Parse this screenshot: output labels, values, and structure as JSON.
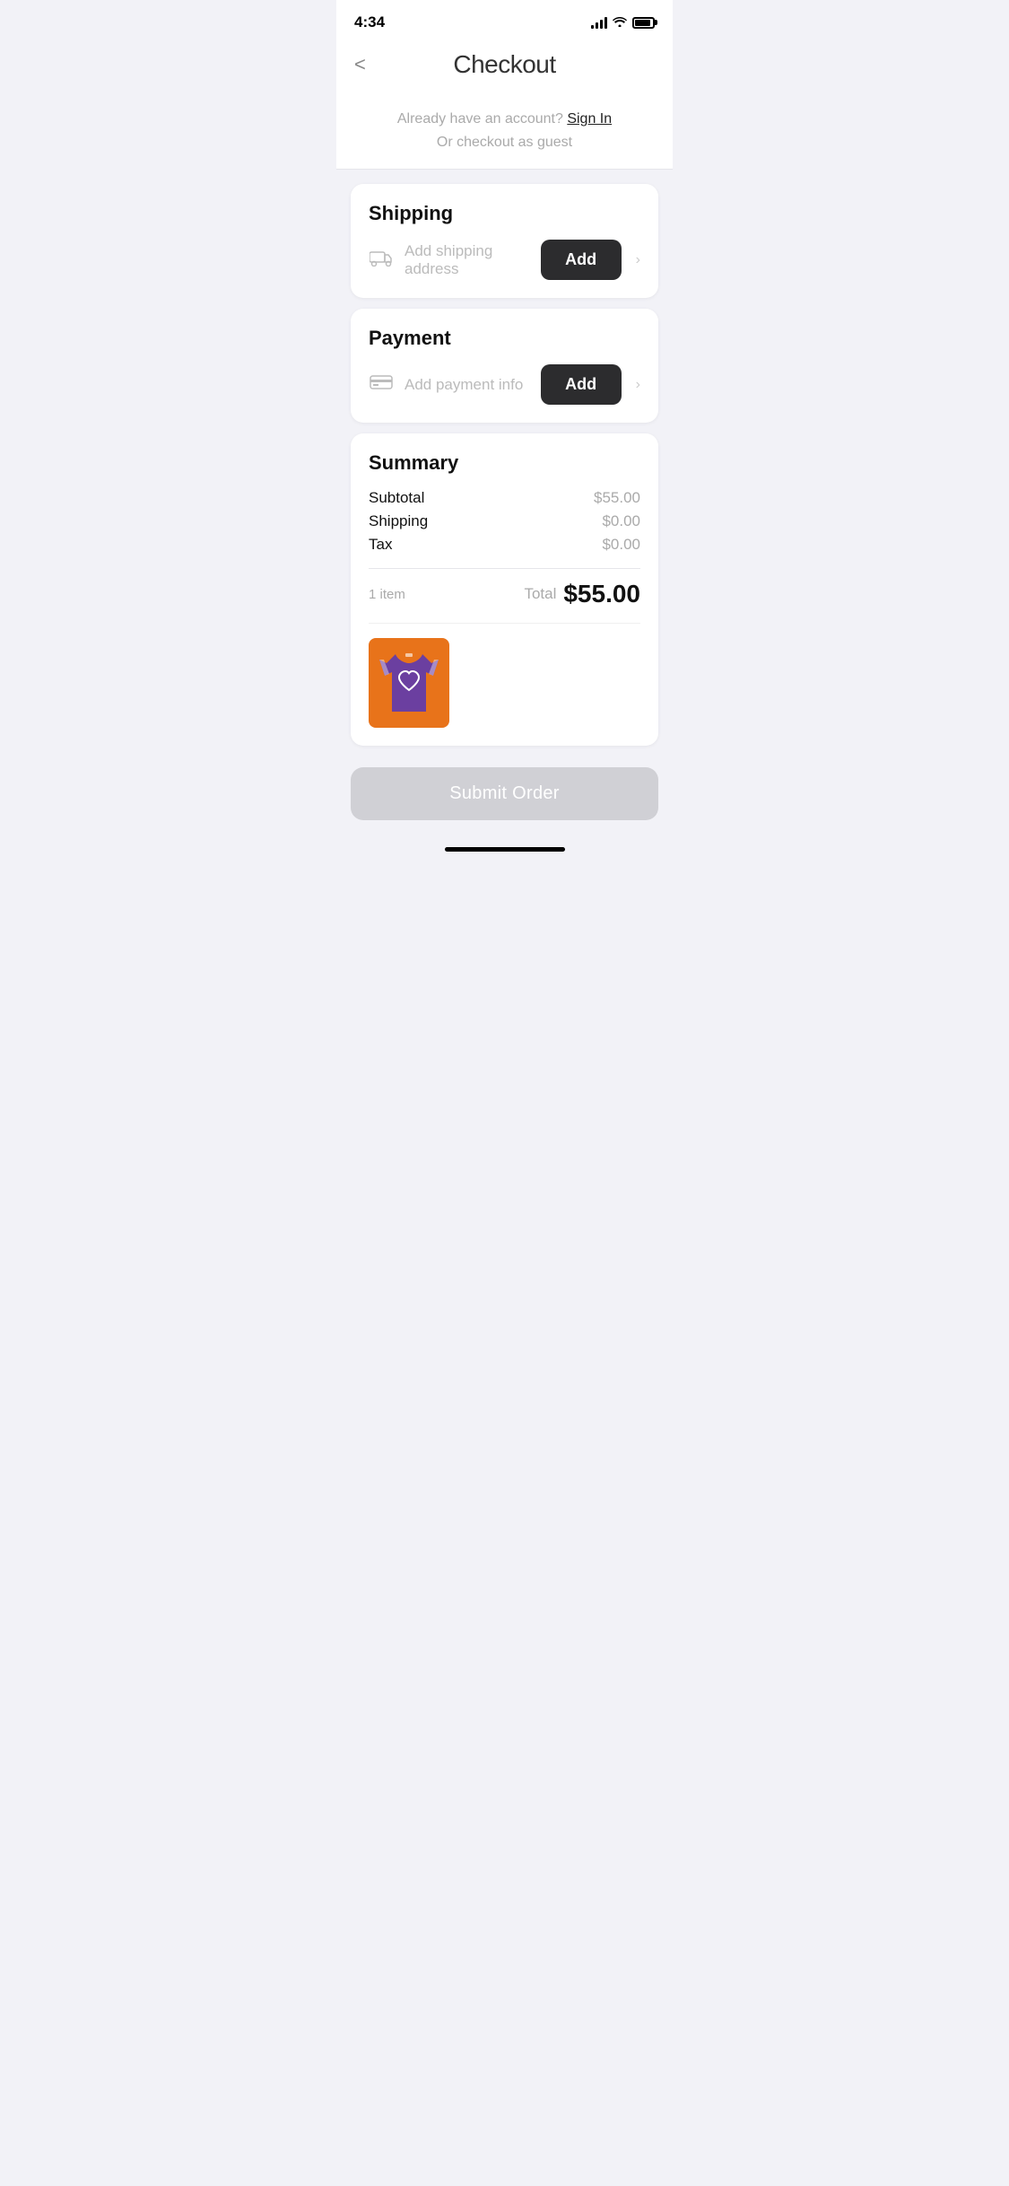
{
  "statusBar": {
    "time": "4:34",
    "signalBars": [
      4,
      7,
      10,
      13
    ],
    "batteryPercent": 80
  },
  "header": {
    "backLabel": "<",
    "title": "Checkout"
  },
  "auth": {
    "promptText": "Already have an account?",
    "signInLabel": "Sign In",
    "guestLabel": "Or checkout as guest"
  },
  "shipping": {
    "sectionTitle": "Shipping",
    "placeholderText": "Add shipping address",
    "addButtonLabel": "Add"
  },
  "payment": {
    "sectionTitle": "Payment",
    "placeholderText": "Add payment info",
    "addButtonLabel": "Add"
  },
  "summary": {
    "sectionTitle": "Summary",
    "subtotalLabel": "Subtotal",
    "subtotalValue": "$55.00",
    "shippingLabel": "Shipping",
    "shippingValue": "$0.00",
    "taxLabel": "Tax",
    "taxValue": "$0.00",
    "itemCount": "1 item",
    "totalLabel": "Total",
    "totalValue": "$55.00"
  },
  "submitButton": {
    "label": "Submit Order"
  }
}
